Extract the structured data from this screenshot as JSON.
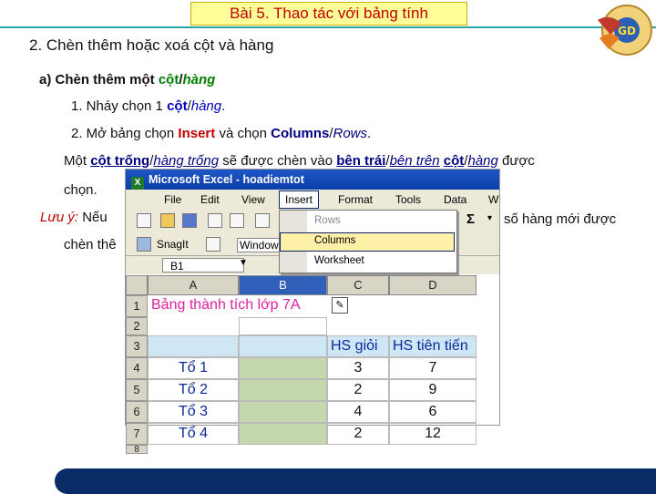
{
  "title": "Bài 5. Thao tác với bảng tính",
  "section_heading": "2. Chèn thêm hoặc xoá cột và hàng",
  "sub_heading": {
    "prefix": "a) Chèn thêm một ",
    "col": "cột",
    "slash": "/",
    "row": "hàng"
  },
  "step1": {
    "text": "1.  Nháy chọn 1 ",
    "col": "cột",
    "slash": "/",
    "row": "hàng",
    "end": "."
  },
  "step2": {
    "text": "2.  Mở bảng chọn ",
    "insert": "Insert",
    "mid": " và chọn ",
    "cols": "Columns",
    "slash": "/",
    "rows": "Rows",
    "end": "."
  },
  "para1": {
    "a": "Một ",
    "b": "cột trống",
    "c": "/",
    "d": "hàng trống",
    "e": " sẽ được chèn vào ",
    "f": "bên trái",
    "g": "/",
    "h": "bên trên",
    "i": " ",
    "j": "cột",
    "k": "/",
    "l": "hàng",
    "m": " được",
    "line2": "chọn."
  },
  "note": {
    "label": "Lưu ý:",
    "text": " Nếu",
    "tail": "số hàng mới được",
    "line2": "chèn thê"
  },
  "excel": {
    "window_title": "Microsoft Excel - hoadiemtot",
    "menus": [
      "File",
      "Edit",
      "View",
      "Insert",
      "Format",
      "Tools",
      "Data",
      "W"
    ],
    "insert_menu": [
      "Rows",
      "Columns",
      "Worksheet"
    ],
    "snagit_label": "SnagIt",
    "window_label": "Window",
    "sigma": "Σ",
    "name_box": "B1",
    "columns": [
      "A",
      "B",
      "C",
      "D"
    ],
    "rows": [
      "1",
      "2",
      "3",
      "4",
      "5",
      "6",
      "7",
      "8"
    ],
    "a1": "Bảng thành tích lớp 7A",
    "c3": "HS giỏi",
    "d3": "HS tiên tiến",
    "teams": [
      "Tổ 1",
      "Tổ 2",
      "Tổ 3",
      "Tổ 4"
    ],
    "gioi": [
      "3",
      "2",
      "4",
      "2"
    ],
    "tientien": [
      "7",
      "9",
      "6",
      "12"
    ]
  },
  "logo_text": "GD"
}
